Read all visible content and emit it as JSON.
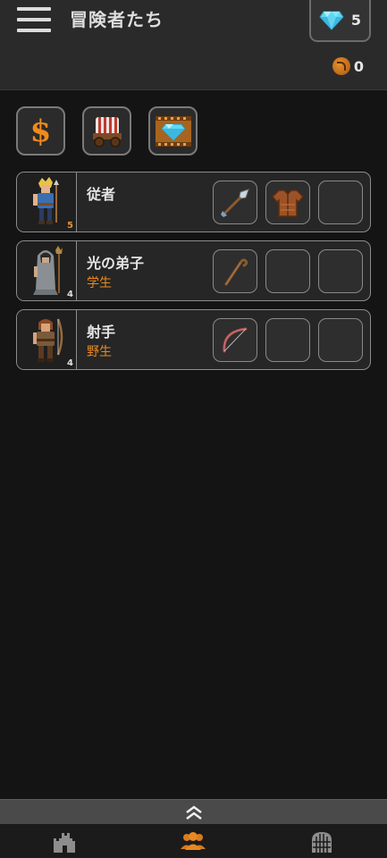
{
  "header": {
    "title": "冒険者たち",
    "gems": "5",
    "coins": "0"
  },
  "shop": [
    {
      "name": "gold-shop",
      "icon": "dollar-sign-icon",
      "glyph": "$"
    },
    {
      "name": "wagon-shop",
      "icon": "wagon-icon"
    },
    {
      "name": "gem-ad-shop",
      "icon": "film-gem-icon"
    }
  ],
  "heroes": [
    {
      "name": "従者",
      "class": "",
      "level": "5",
      "level_color": "#e0962e",
      "slots": [
        "spear-icon",
        "leather-armor-icon",
        ""
      ]
    },
    {
      "name": "光の弟子",
      "class": "学生",
      "level": "4",
      "level_color": "#e0e0e0",
      "slots": [
        "staff-icon",
        "",
        ""
      ]
    },
    {
      "name": "射手",
      "class": "野生",
      "level": "4",
      "level_color": "#e0e0e0",
      "slots": [
        "bow-icon",
        "",
        ""
      ]
    }
  ],
  "nav": [
    "castle-icon",
    "party-icon",
    "gate-icon"
  ],
  "colors": {
    "accent": "#e8891f",
    "bg": "#141414",
    "card": "#262626",
    "header": "#2a2a2a"
  }
}
